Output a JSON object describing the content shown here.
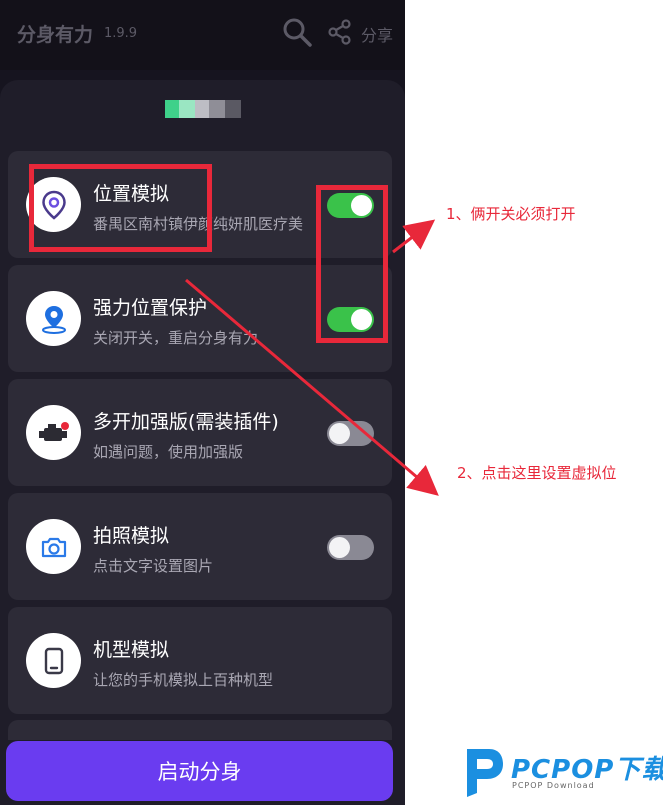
{
  "header": {
    "title": "分身有力",
    "version": "1.9.9",
    "search_icon": "search-icon",
    "share_icon": "share-icon",
    "share_label": "分享"
  },
  "settings": [
    {
      "title": "位置模拟",
      "subtitle": "番禺区南村镇伊颜纯妍肌医疗美",
      "icon": "location-pin-icon",
      "enabled": true
    },
    {
      "title": "强力位置保护",
      "subtitle": "关闭开关，重启分身有力",
      "icon": "map-pin-shield-icon",
      "enabled": true
    },
    {
      "title": "多开加强版(需装插件)",
      "subtitle": "如遇问题，使用加强版",
      "icon": "engine-icon",
      "enabled": false
    },
    {
      "title": "拍照模拟",
      "subtitle": "点击文字设置图片",
      "icon": "camera-icon",
      "enabled": false
    },
    {
      "title": "机型模拟",
      "subtitle": "让您的手机模拟上百种机型",
      "icon": "phone-device-icon",
      "enabled": false
    }
  ],
  "start_button": "启动分身",
  "annotations": {
    "note1": "1、俩开关必须打开",
    "note2": "2、点击这里设置虚拟位"
  },
  "watermark": {
    "brand": "PCPOP下载",
    "sub": "PCPOP Download"
  },
  "colors": {
    "toggle_on": "#3ac24a",
    "toggle_off": "#8a8994",
    "accent_button": "#6a3cf0",
    "annotation_red": "#e8283a",
    "watermark_blue": "#1b8fe0"
  }
}
